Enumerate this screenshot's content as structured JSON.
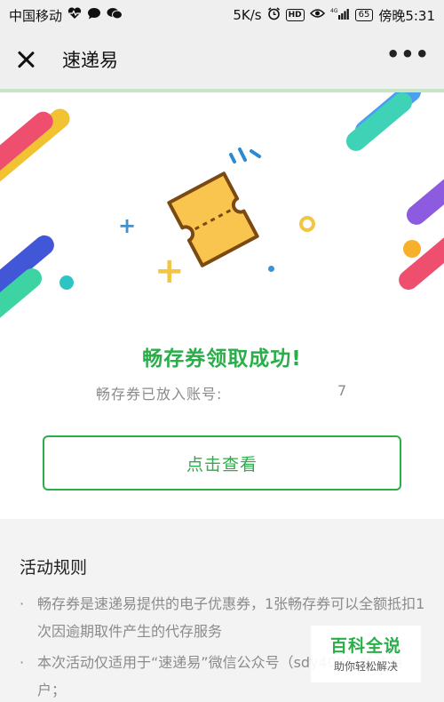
{
  "statusbar": {
    "carrier": "中国移动",
    "icons_left": [
      "heart-pulse-icon",
      "message-bubble-icon",
      "wechat-icon"
    ],
    "speed": "5K/s",
    "hd": "HD",
    "battery": "65",
    "time": "傍晚5:31"
  },
  "titlebar": {
    "title": "速递易",
    "more": "•••"
  },
  "success": {
    "title": "畅存券领取成功!",
    "account_label": "畅存券已放入账号:",
    "account_value": "7",
    "view_button": "点击查看"
  },
  "rules": {
    "title": "活动规则",
    "items": [
      {
        "bullet": "·",
        "text": "畅存券是速递易提供的电子优惠券，1张畅存券可以全额抵扣1次因逾期取件产生的代存服务"
      },
      {
        "bullet": "·",
        "text": "本次活动仅适用于“速递易”微信公众号（sdy400）关注用户；"
      }
    ]
  },
  "watermark": {
    "main": "百科全说",
    "sub": "助你轻松解决"
  },
  "colors": {
    "accent_green": "#2aae4a",
    "ticket_yellow": "#f9c54e",
    "progress_green": "#c6e5c5"
  }
}
